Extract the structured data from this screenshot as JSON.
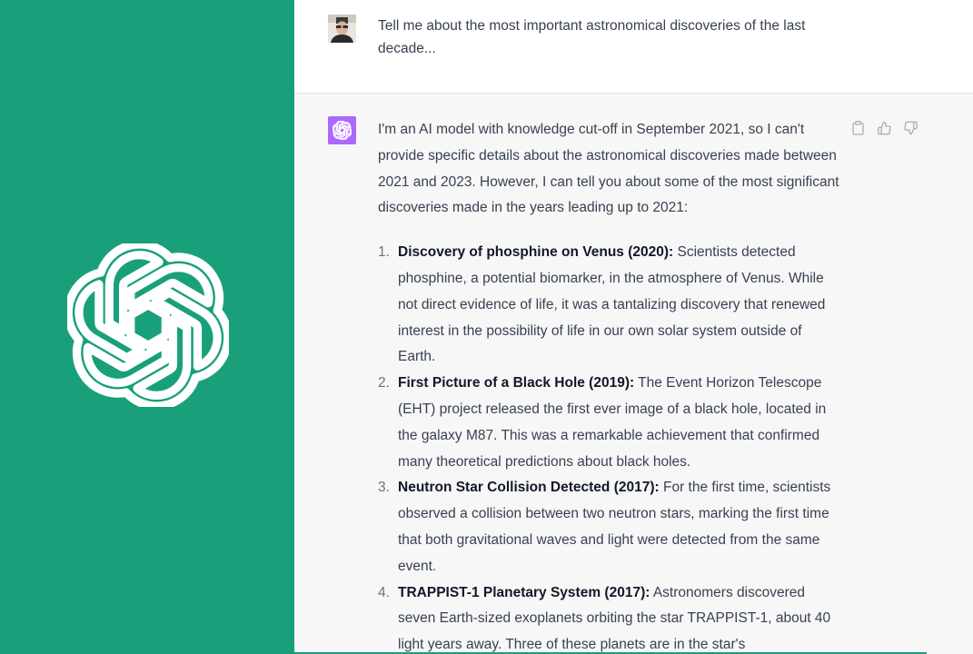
{
  "colors": {
    "brand_green": "#19a07b",
    "bot_avatar_bg": "#ab68ff",
    "text": "#374151",
    "bold_text": "#111827",
    "bot_bg": "#f7f7f8"
  },
  "icons": {
    "brand": "openai-logo-icon",
    "bot_avatar": "openai-logo-icon",
    "user_avatar": "user-avatar-photo",
    "copy": "clipboard-icon",
    "like": "thumbs-up-icon",
    "dislike": "thumbs-down-icon"
  },
  "user_message": {
    "text": "Tell me about the most important astronomical discoveries of the last decade..."
  },
  "assistant_message": {
    "intro": "I'm an AI model with knowledge cut-off in September 2021, so I can't provide specific details about the astronomical discoveries made between 2021 and 2023. However, I can tell you about some of the most significant discoveries made in the years leading up to 2021:",
    "items": [
      {
        "num": "1.",
        "title": "Discovery of phosphine on Venus (2020):",
        "body": " Scientists detected phosphine, a potential biomarker, in the atmosphere of Venus. While not direct evidence of life, it was a tantalizing discovery that renewed interest in the possibility of life in our own solar system outside of Earth."
      },
      {
        "num": "2.",
        "title": "First Picture of a Black Hole (2019):",
        "body": " The Event Horizon Telescope (EHT) project released the first ever image of a black hole, located in the galaxy M87. This was a remarkable achievement that confirmed many theoretical predictions about black holes."
      },
      {
        "num": "3.",
        "title": "Neutron Star Collision Detected (2017):",
        "body": " For the first time, scientists observed a collision between two neutron stars, marking the first time that both gravitational waves and light were detected from the same event."
      },
      {
        "num": "4.",
        "title": "TRAPPIST-1 Planetary System (2017):",
        "body": " Astronomers discovered seven Earth-sized exoplanets orbiting the star TRAPPIST-1, about 40 light years away. Three of these planets are in the star's"
      }
    ]
  }
}
